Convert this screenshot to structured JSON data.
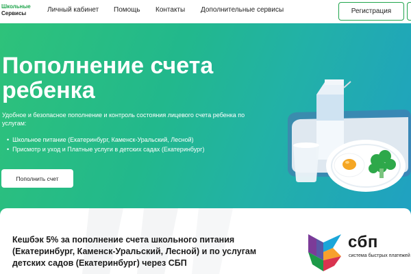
{
  "header": {
    "logo": {
      "line1": "Школьные",
      "line2": "Сервисы"
    },
    "nav": [
      {
        "label": "Личный кабинет"
      },
      {
        "label": "Помощь"
      },
      {
        "label": "Контакты"
      },
      {
        "label": "Дополнительные сервисы"
      }
    ],
    "register_label": "Регистрация"
  },
  "hero": {
    "title": "Пополнение счета ребенка",
    "description": "Удобное и безопасное пополнение и контроль состояния лицевого счета ребенка по услугам:",
    "items": [
      "Школьное питание (Екатеринбург, Каменск-Уральский, Лесной)",
      "Присмотр и уход и Платные услуги в детских садах (Екатеринбург)"
    ],
    "button_label": "Пополнить счет"
  },
  "cashback": {
    "text": "Кешбэк 5% за пополнение счета школьного питания (Екатеринбург, Каменск-Уральский, Лесной) и по услугам детских садов (Екатеринбург) через СБП",
    "sbp_logo": "сбп",
    "sbp_subtitle": "система быстрых платежей"
  },
  "colors": {
    "brand_green": "#1fa44b",
    "gradient_start": "#2ec27a",
    "gradient_end": "#1f9fc5"
  }
}
